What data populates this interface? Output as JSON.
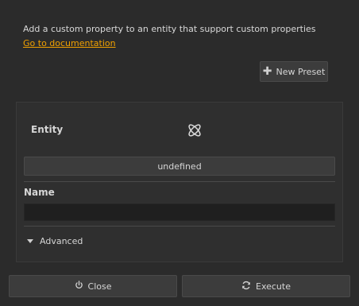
{
  "header": {
    "description": "Add a custom property to an entity that support custom properties",
    "doc_link": "Go to documentation"
  },
  "toolbar": {
    "new_preset_label": "New Preset",
    "new_preset_icon": "plus-icon"
  },
  "panel": {
    "entity_label": "Entity",
    "entity_icon": "entity-icon",
    "entity_value": "undefined",
    "name_label": "Name",
    "name_value": "",
    "advanced_label": "Advanced"
  },
  "footer": {
    "close_label": "Close",
    "close_icon": "power-icon",
    "execute_label": "Execute",
    "execute_icon": "refresh-icon"
  },
  "colors": {
    "background": "#2b2b2b",
    "link": "#f0a000",
    "input_bg": "#1f1f1f"
  }
}
